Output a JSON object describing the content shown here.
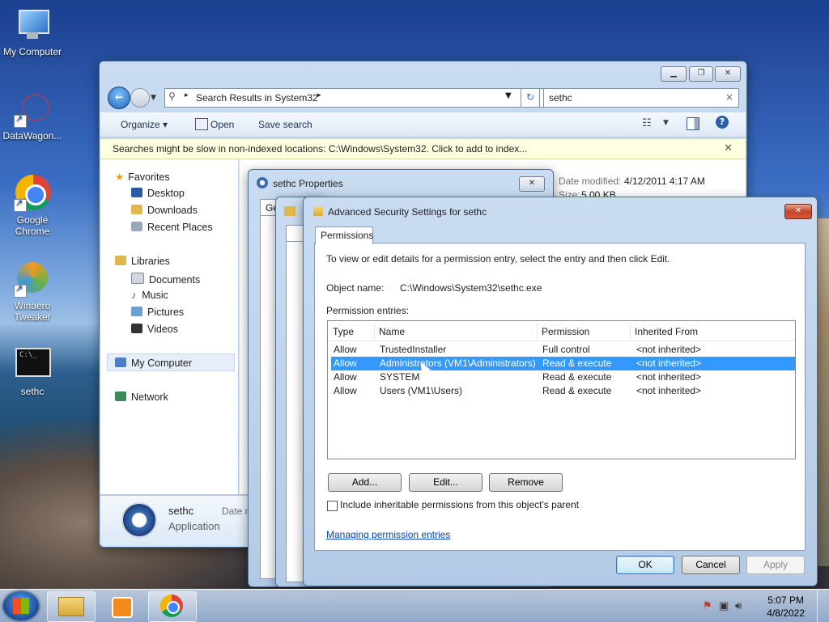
{
  "desktop": {
    "icons": [
      {
        "label": "My Computer"
      },
      {
        "label": "DataWagon..."
      },
      {
        "label": "Google Chrome"
      },
      {
        "label": "Winaero Tweaker"
      },
      {
        "label": "sethc"
      }
    ]
  },
  "explorer": {
    "address": "Search Results in System32",
    "search_value": "sethc",
    "toolbar": {
      "organize": "Organize",
      "open": "Open",
      "save_search": "Save search"
    },
    "infobar": "Searches might be slow in non-indexed locations: C:\\Windows\\System32. Click to add to index...",
    "nav": {
      "favorites": "Favorites",
      "desktop": "Desktop",
      "downloads": "Downloads",
      "recent_places": "Recent Places",
      "libraries": "Libraries",
      "documents": "Documents",
      "music": "Music",
      "pictures": "Pictures",
      "videos": "Videos",
      "my_computer": "My Computer",
      "network": "Network"
    },
    "result": {
      "date_modified_label": "Date modified:",
      "date_modified": "4/12/2011 4:17 AM",
      "size_label": "Size:",
      "size": "5.00 KB"
    },
    "details": {
      "name": "sethc",
      "type": "Application",
      "date_label": "Date m"
    }
  },
  "props_window": {
    "title": "sethc Properties",
    "tab_partial": "Ge"
  },
  "advanced": {
    "title": "Advanced Security Settings for sethc",
    "tab": "Permissions",
    "intro": "To view or edit details for a permission entry, select the entry and then click Edit.",
    "object_name_label": "Object name:",
    "object_name": "C:\\Windows\\System32\\sethc.exe",
    "entries_label": "Permission entries:",
    "columns": [
      "Type",
      "Name",
      "Permission",
      "Inherited From"
    ],
    "rows": [
      {
        "type": "Allow",
        "name": "TrustedInstaller",
        "permission": "Full control",
        "inherited": "<not inherited>"
      },
      {
        "type": "Allow",
        "name": "Administrators (VM1\\Administrators)",
        "permission": "Read & execute",
        "inherited": "<not inherited>"
      },
      {
        "type": "Allow",
        "name": "SYSTEM",
        "permission": "Read & execute",
        "inherited": "<not inherited>"
      },
      {
        "type": "Allow",
        "name": "Users (VM1\\Users)",
        "permission": "Read & execute",
        "inherited": "<not inherited>"
      }
    ],
    "buttons": {
      "add": "Add...",
      "edit": "Edit...",
      "remove": "Remove"
    },
    "inherit_checkbox": "Include inheritable permissions from this object's parent",
    "help_link": "Managing permission entries",
    "ok": "OK",
    "cancel": "Cancel",
    "apply": "Apply"
  },
  "taskbar": {
    "time": "5:07 PM",
    "date": "4/8/2022"
  }
}
